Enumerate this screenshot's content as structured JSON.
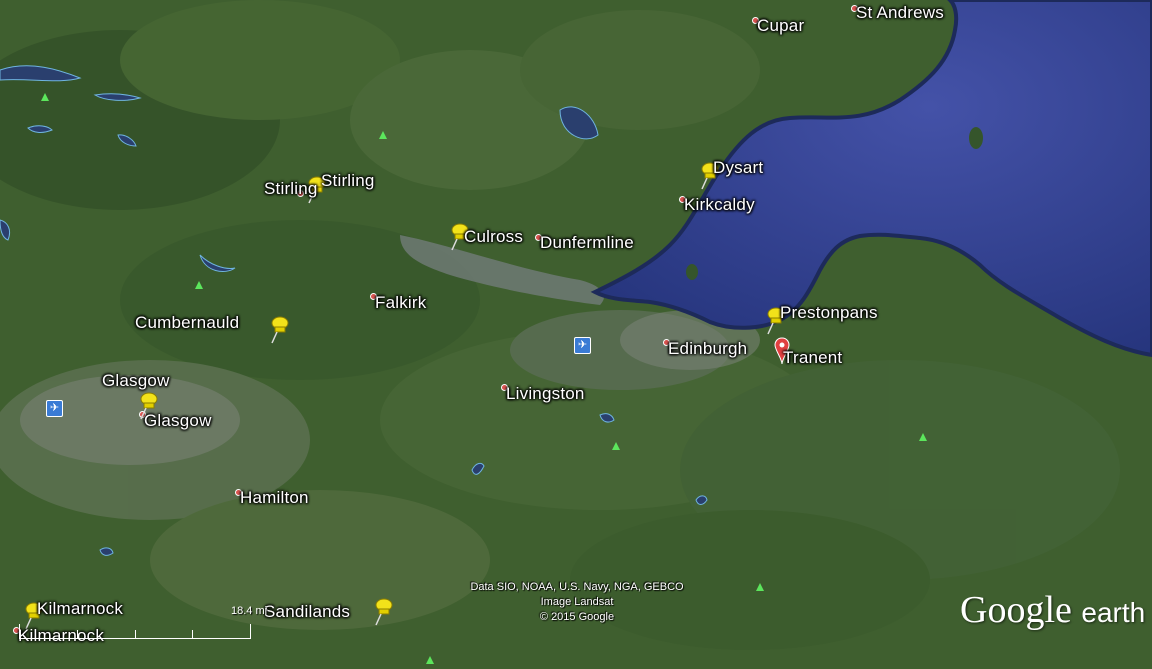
{
  "places": {
    "cupar": "Cupar",
    "st_andrews": "St Andrews",
    "dysart": "Dysart",
    "kirkcaldy": "Kirkcaldy",
    "stirling_pin": "Stirling",
    "stirling": "Stirling",
    "culross": "Culross",
    "dunfermline": "Dunfermline",
    "falkirk": "Falkirk",
    "cumbernauld": "Cumbernauld",
    "prestonpans": "Prestonpans",
    "edinburgh": "Edinburgh",
    "tranent": "Tranent",
    "glasgow_pin": "Glasgow",
    "glasgow": "Glasgow",
    "livingston": "Livingston",
    "hamilton": "Hamilton",
    "kilmarnock_pin": "Kilmarnock",
    "kilmarnock": "Kilmarnock",
    "sandilands": "Sandilands"
  },
  "attribution": {
    "line1": "Data SIO, NOAA, U.S. Navy, NGA, GEBCO",
    "line2": "Image Landsat",
    "line3": "© 2015 Google"
  },
  "scale": {
    "label": "18.4 mi"
  },
  "brand": {
    "google": "Google",
    "earth": "earth"
  },
  "icons": {
    "pushpin": "pushpin-icon",
    "place_marker": "place-marker-icon",
    "airport": "airport-icon",
    "peak": "mountain-peak-icon"
  },
  "colors": {
    "sea": "#2f3f8f",
    "land": "#3d5e2e",
    "pin_yellow": "#f2e21a",
    "marker_red": "#e04040"
  }
}
